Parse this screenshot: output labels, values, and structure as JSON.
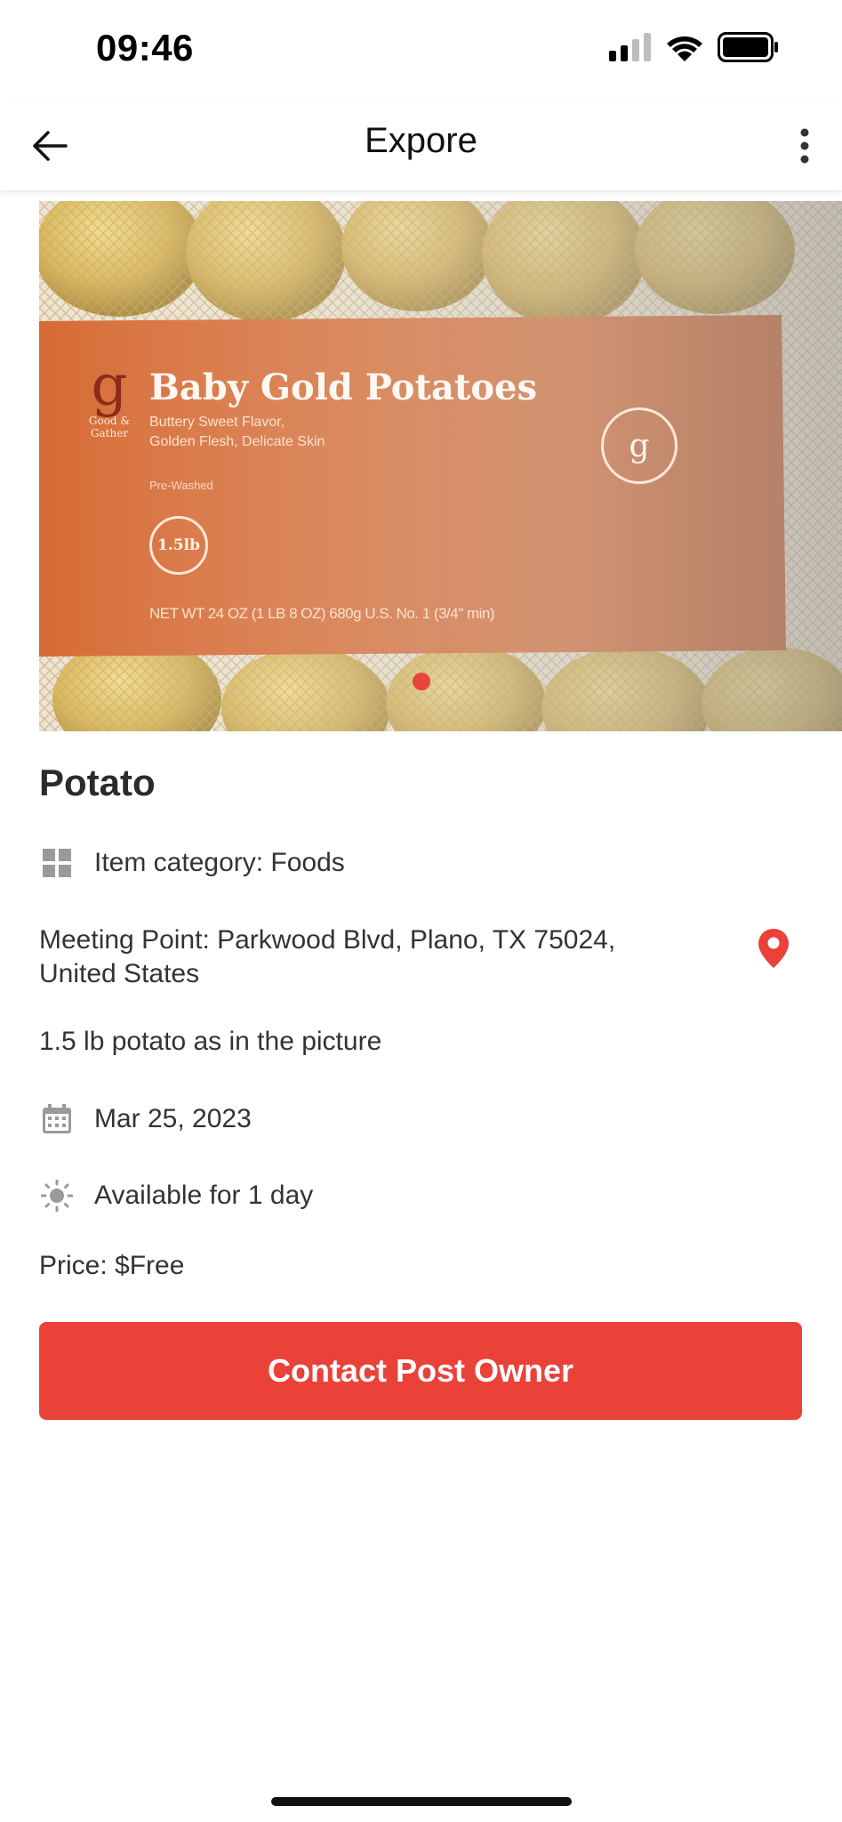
{
  "status_bar": {
    "time": "09:46"
  },
  "nav": {
    "title": "Expore"
  },
  "product_image": {
    "brand": "Good & Gather",
    "product_name": "Baby Gold Potatoes",
    "tagline_1": "Buttery Sweet Flavor,",
    "tagline_2": "Golden Flesh, Delicate Skin",
    "pre_washed": "Pre-Washed",
    "weight_badge": "1.5lb",
    "net_wt": "NET WT 24 OZ (1 LB 8 OZ) 680g   U.S. No. 1 (3/4\" min)"
  },
  "item": {
    "title": "Potato",
    "category": "Item category: Foods",
    "meeting_point": "Meeting Point: Parkwood Blvd, Plano, TX  75024, United States",
    "description": "1.5 lb potato as in the picture",
    "date": "Mar 25, 2023",
    "availability": "Available for 1 day",
    "price": "Price: $Free"
  },
  "actions": {
    "contact_label": "Contact Post Owner"
  },
  "colors": {
    "accent": "#ea4139",
    "bag_orange": "#d9703a",
    "icon_gray": "#9a9a9a"
  },
  "icons": {
    "back": "arrow-left-icon",
    "more": "more-vertical-icon",
    "category": "grid-icon",
    "location": "map-pin-icon",
    "date": "calendar-icon",
    "availability": "sun-icon"
  }
}
